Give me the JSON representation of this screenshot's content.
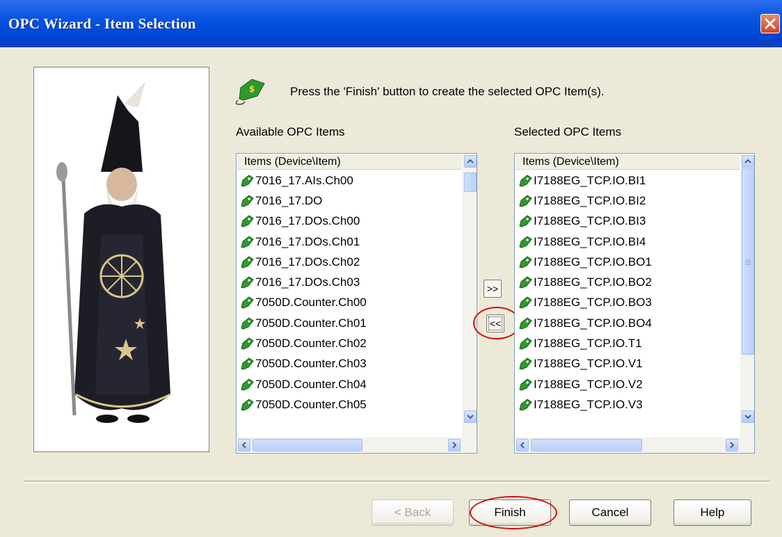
{
  "window": {
    "title": "OPC Wizard - Item Selection"
  },
  "instruction": "Press the 'Finish' button to create the selected OPC Item(s).",
  "available": {
    "label": "Available OPC Items",
    "header": "Items (Device\\Item)",
    "items": [
      "7016_17.AIs.Ch00",
      "7016_17.DO",
      "7016_17.DOs.Ch00",
      "7016_17.DOs.Ch01",
      "7016_17.DOs.Ch02",
      "7016_17.DOs.Ch03",
      "7050D.Counter.Ch00",
      "7050D.Counter.Ch01",
      "7050D.Counter.Ch02",
      "7050D.Counter.Ch03",
      "7050D.Counter.Ch04",
      "7050D.Counter.Ch05"
    ]
  },
  "selected": {
    "label": "Selected OPC Items",
    "header": "Items (Device\\Item)",
    "items": [
      "I7188EG_TCP.IO.BI1",
      "I7188EG_TCP.IO.BI2",
      "I7188EG_TCP.IO.BI3",
      "I7188EG_TCP.IO.BI4",
      "I7188EG_TCP.IO.BO1",
      "I7188EG_TCP.IO.BO2",
      "I7188EG_TCP.IO.BO3",
      "I7188EG_TCP.IO.BO4",
      "I7188EG_TCP.IO.T1",
      "I7188EG_TCP.IO.V1",
      "I7188EG_TCP.IO.V2",
      "I7188EG_TCP.IO.V3"
    ]
  },
  "transfer": {
    "add_label": ">>",
    "remove_label": "<<"
  },
  "buttons": {
    "back": "< Back",
    "finish": "Finish",
    "cancel": "Cancel",
    "help": "Help"
  },
  "icons": {
    "item": "opc-tag-icon",
    "wizard": "wizard-image",
    "instruction": "opc-item-icon"
  },
  "colors": {
    "titlebar": "#0a56e3",
    "highlight_ellipse": "#d01010",
    "item_icon": "#2e9a2e"
  }
}
